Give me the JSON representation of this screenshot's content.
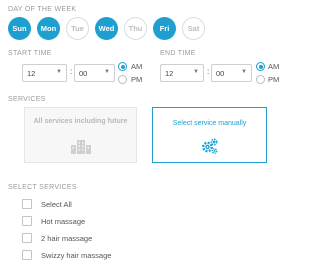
{
  "day_of_week": {
    "title": "DAY OF THE WEEK",
    "days": [
      {
        "label": "Sun",
        "selected": false
      },
      {
        "label": "Mon",
        "selected": true
      },
      {
        "label": "Tue",
        "selected": false
      },
      {
        "label": "Wed",
        "selected": true
      },
      {
        "label": "Thu",
        "selected": false
      },
      {
        "label": "Fri",
        "selected": true
      },
      {
        "label": "Sat",
        "selected": false
      }
    ]
  },
  "start_time": {
    "title": "START TIME",
    "hour": "12",
    "minute": "00",
    "colon": ":",
    "am_label": "AM",
    "pm_label": "PM",
    "period": "AM"
  },
  "end_time": {
    "title": "END TIME",
    "hour": "12",
    "minute": "00",
    "colon": ":",
    "am_label": "AM",
    "pm_label": "PM",
    "period": "AM"
  },
  "services": {
    "title": "SERVICES",
    "all_services_label": "All services including future",
    "manual_label": "Select service manually",
    "selected_option": "manual"
  },
  "select_services": {
    "title": "SELECT SERVICES",
    "items": [
      {
        "label": "Select All",
        "checked": false
      },
      {
        "label": "Hot massage",
        "checked": false
      },
      {
        "label": "2 hair massage",
        "checked": false
      },
      {
        "label": "Swizzy hair massage",
        "checked": false
      }
    ]
  },
  "colors": {
    "accent": "#1e9fd0",
    "muted_text": "#9a9a9a",
    "disabled_border": "#e6e6e6"
  },
  "icons": {
    "dropdown": "triangle-down-icon",
    "all_services": "building-icon",
    "manual": "gears-icon"
  }
}
